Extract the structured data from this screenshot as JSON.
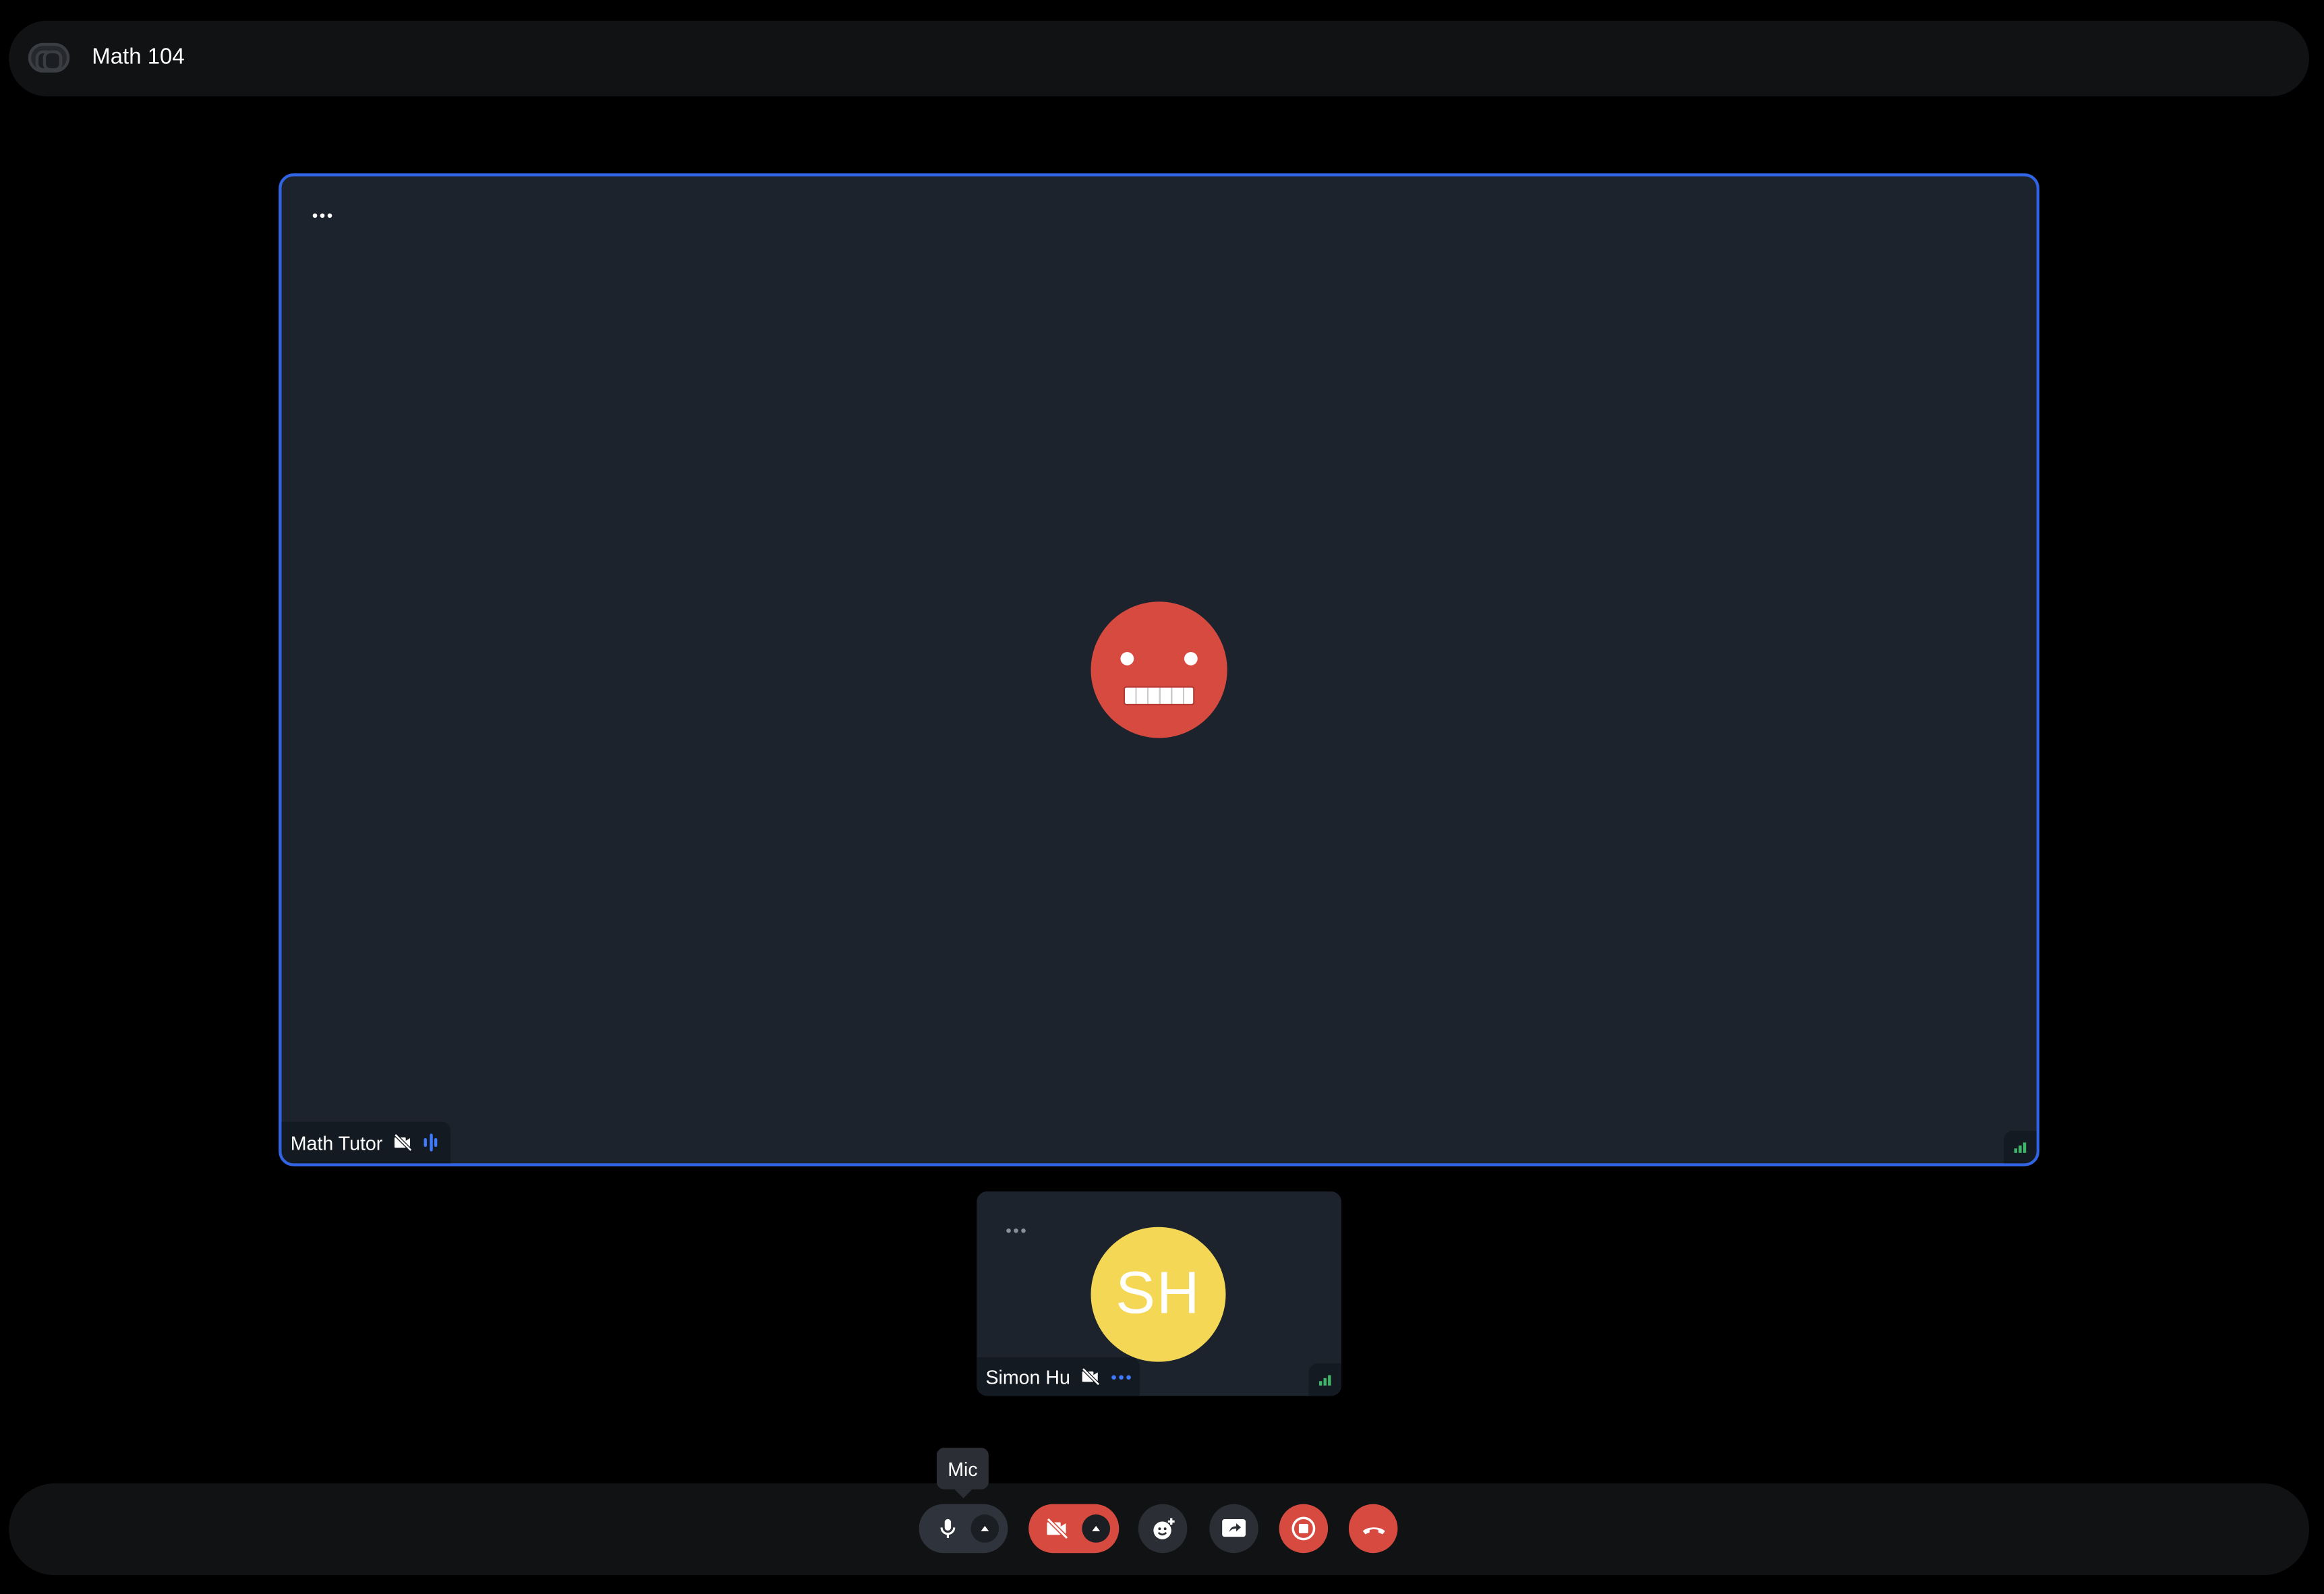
{
  "window": {
    "title": "Math 104",
    "logo_icon": "app-logo-icon"
  },
  "main_tile": {
    "participant_name": "Math Tutor",
    "avatar_type": "emoji-grimace-face",
    "avatar_color": "#d64a40",
    "active_speaker_border_color": "#3064e3",
    "status_icons": [
      "camera-off-icon",
      "speaking-indicator-icon"
    ],
    "menu_icon": "more-options-icon",
    "connection_icon": "signal-strength-icon"
  },
  "participant_tile": {
    "participant_name": "Simon Hu",
    "initials": "SH",
    "avatar_color": "#f5d756",
    "status_icons": [
      "camera-off-icon",
      "more-dots-icon"
    ],
    "menu_icon": "more-options-icon",
    "connection_icon": "signal-strength-icon"
  },
  "controls": {
    "tooltip": "Mic",
    "buttons": [
      {
        "name": "mic-button",
        "icon": "mic-icon",
        "has_menu": true
      },
      {
        "name": "camera-button",
        "icon": "camera-off-icon",
        "has_menu": true,
        "state": "off"
      },
      {
        "name": "reactions-button",
        "icon": "emoji-add-icon"
      },
      {
        "name": "share-screen-button",
        "icon": "share-screen-icon"
      },
      {
        "name": "record-button",
        "icon": "stop-record-icon"
      },
      {
        "name": "leave-button",
        "icon": "hang-up-icon"
      }
    ],
    "colors": {
      "danger": "#d64a40",
      "neutral": "#2b2f35"
    }
  }
}
